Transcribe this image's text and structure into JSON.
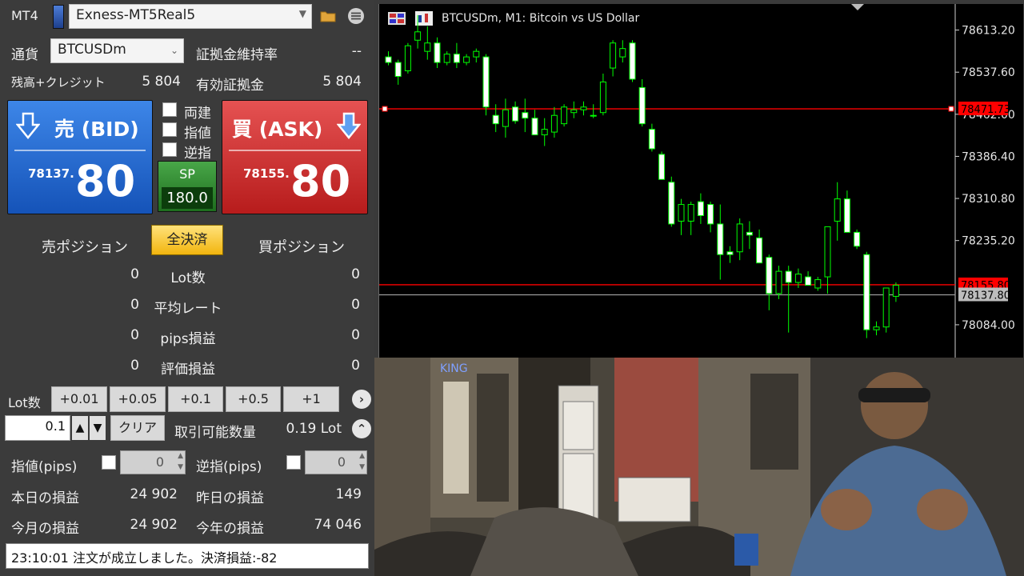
{
  "header": {
    "platform": "MT4",
    "account": "Exness-MT5Real5"
  },
  "currency": {
    "label": "通貨",
    "symbol": "BTCUSDm"
  },
  "margin_level": {
    "label": "証拠金維持率",
    "value": "--"
  },
  "balance": {
    "label": "残高+クレジット",
    "value": "5 804"
  },
  "equity": {
    "label": "有効証拠金",
    "value": "5 804"
  },
  "sell": {
    "title": "売 (BID)",
    "small": "78137.",
    "large": "80"
  },
  "buy": {
    "title": "買 (ASK)",
    "small": "78155.",
    "large": "80"
  },
  "options": [
    "両建",
    "指値",
    "逆指"
  ],
  "spread": {
    "label": "SP",
    "value": "180.0"
  },
  "positions": {
    "sell_header": "売ポジション",
    "close_all": "全決済",
    "buy_header": "買ポジション",
    "rows": [
      {
        "label": "Lot数",
        "sell": "0",
        "buy": "0"
      },
      {
        "label": "平均レート",
        "sell": "0",
        "buy": "0"
      },
      {
        "label": "pips損益",
        "sell": "0",
        "buy": "0"
      },
      {
        "label": "評価損益",
        "sell": "0",
        "buy": "0"
      }
    ]
  },
  "lot": {
    "label": "Lot数",
    "buttons": [
      "+0.01",
      "+0.05",
      "+0.1",
      "+0.5",
      "+1"
    ],
    "value": "0.1",
    "clear": "クリア",
    "tradable_label": "取引可能数量",
    "tradable_value": "0.19 Lot"
  },
  "limit": {
    "label": "指値(pips)",
    "value": "0"
  },
  "stop": {
    "label": "逆指(pips)",
    "value": "0"
  },
  "pl": {
    "today_label": "本日の損益",
    "today": "24 902",
    "yesterday_label": "昨日の損益",
    "yesterday": "149",
    "month_label": "今月の損益",
    "month": "24 902",
    "year_label": "今年の損益",
    "year": "74 046"
  },
  "status": "23:10:01 注文が成立しました。決済損益:-82",
  "chart_data": {
    "type": "candlestick",
    "title": "BTCUSDm, M1:  Bitcoin vs US Dollar",
    "y_ticks": [
      "78613.20",
      "78537.60",
      "78462.00",
      "78386.40",
      "78310.80",
      "78235.20",
      "78084.00"
    ],
    "y_range": [
      78025,
      78660
    ],
    "lines": [
      {
        "name": "line-upper",
        "value": 78471.73,
        "label": "78471.73",
        "color": "#ff0000"
      },
      {
        "name": "ask-line",
        "value": 78155.8,
        "label": "78155.80",
        "color": "#ff0000"
      },
      {
        "name": "bid-line",
        "value": 78137.8,
        "label": "78137.80",
        "color": "#9a9a9a"
      }
    ],
    "candles": [
      [
        78565,
        78575,
        78550,
        78555
      ],
      [
        78555,
        78560,
        78515,
        78530
      ],
      [
        78540,
        78590,
        78535,
        78585
      ],
      [
        78595,
        78640,
        78580,
        78610
      ],
      [
        78575,
        78620,
        78560,
        78590
      ],
      [
        78590,
        78600,
        78545,
        78555
      ],
      [
        78555,
        78575,
        78550,
        78570
      ],
      [
        78570,
        78590,
        78545,
        78555
      ],
      [
        78555,
        78570,
        78550,
        78565
      ],
      [
        78565,
        78580,
        78555,
        78575
      ],
      [
        78565,
        78570,
        78460,
        78475
      ],
      [
        78460,
        78480,
        78430,
        78445
      ],
      [
        78440,
        78490,
        78420,
        78470
      ],
      [
        78475,
        78485,
        78445,
        78450
      ],
      [
        78465,
        78490,
        78430,
        78455
      ],
      [
        78455,
        78470,
        78425,
        78425
      ],
      [
        78425,
        78455,
        78405,
        78435
      ],
      [
        78430,
        78475,
        78420,
        78460
      ],
      [
        78445,
        78480,
        78440,
        78475
      ],
      [
        78465,
        78485,
        78455,
        78470
      ],
      [
        78470,
        78485,
        78460,
        78475
      ],
      [
        78460,
        78480,
        78455,
        78460
      ],
      [
        78465,
        78535,
        78460,
        78520
      ],
      [
        78545,
        78595,
        78530,
        78590
      ],
      [
        78565,
        78595,
        78555,
        78580
      ],
      [
        78590,
        78595,
        78520,
        78525
      ],
      [
        78510,
        78525,
        78440,
        78445
      ],
      [
        78435,
        78445,
        78395,
        78400
      ],
      [
        78390,
        78395,
        78345,
        78345
      ],
      [
        78340,
        78350,
        78260,
        78265
      ],
      [
        78270,
        78310,
        78245,
        78300
      ],
      [
        78270,
        78305,
        78245,
        78300
      ],
      [
        78305,
        78320,
        78265,
        78280
      ],
      [
        78300,
        78305,
        78250,
        78265
      ],
      [
        78265,
        78300,
        78165,
        78210
      ],
      [
        78215,
        78225,
        78195,
        78210
      ],
      [
        78215,
        78275,
        78200,
        78265
      ],
      [
        78250,
        78270,
        78220,
        78245
      ],
      [
        78240,
        78255,
        78195,
        78195
      ],
      [
        78205,
        78210,
        78110,
        78140
      ],
      [
        78140,
        78190,
        78130,
        78180
      ],
      [
        78180,
        78190,
        78070,
        78160
      ],
      [
        78160,
        78185,
        78150,
        78175
      ],
      [
        78170,
        78180,
        78155,
        78155
      ],
      [
        78150,
        78170,
        78145,
        78165
      ],
      [
        78170,
        78260,
        78140,
        78260
      ],
      [
        78270,
        78340,
        78235,
        78310
      ],
      [
        78310,
        78325,
        78255,
        78250
      ],
      [
        78250,
        78255,
        78220,
        78225
      ],
      [
        78210,
        78215,
        78060,
        78075
      ],
      [
        78075,
        78090,
        78065,
        78080
      ],
      [
        78080,
        78150,
        78070,
        78150
      ],
      [
        78135,
        78160,
        78125,
        78155
      ]
    ]
  }
}
